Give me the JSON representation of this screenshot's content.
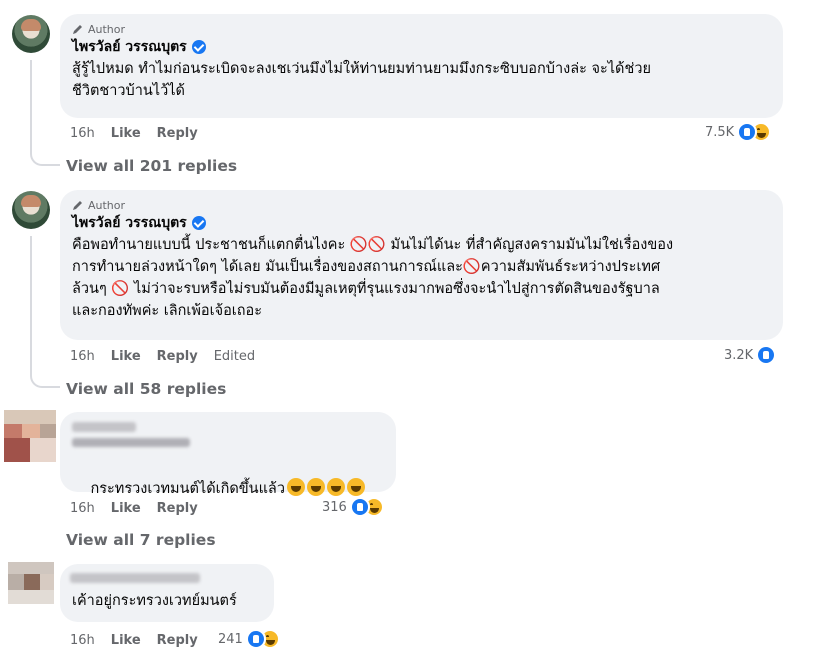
{
  "comments": [
    {
      "author_tag": "Author",
      "name": "ไพรวัลย์ วรรณบุตร",
      "text": "สู้รู้ไปหมด ทำไมก่อนระเบิดจะลงเชเว่นมึงไม่ให้ท่านยมท่านยามมึงกระซิบบอกบ้างล่ะ จะได้ช่วย\nชีวิตชาวบ้านไว้ได้",
      "time": "16h",
      "like": "Like",
      "reply": "Reply",
      "reaction_count": "7.5K",
      "view_replies": "View all 201 replies"
    },
    {
      "author_tag": "Author",
      "name": "ไพรวัลย์ วรรณบุตร",
      "text": "คือพอทำนายแบบนี้ ประชาชนก็แตกตื่นไงคะ 🚫🚫 มันไม่ได้นะ ที่สำคัญสงครามมันไม่ใช่เรื่องของ\nการทำนายล่วงหน้าใดๆ ได้เลย มันเป็นเรื่องของสถานการณ์และ🚫ความสัมพันธ์ระหว่างประเทศ\nล้วนๆ 🚫 ไม่ว่าจะรบหรือไม่รบมันต้องมีมูลเหตุที่รุนแรงมากพอซึ่งจะนำไปสู่การตัดสินของรัฐบาล\nและกองทัพค่ะ เลิกเพ้อเจ้อเถอะ",
      "time": "16h",
      "like": "Like",
      "reply": "Reply",
      "edited": "Edited",
      "reaction_count": "3.2K",
      "view_replies": "View all 58 replies"
    },
    {
      "text": "กระทรวงเวทมนต์ได้เกิดขึ้นแล้ว",
      "time": "16h",
      "like": "Like",
      "reply": "Reply",
      "reaction_count": "316",
      "view_replies": "View all 7 replies"
    },
    {
      "text": "เค้าอยู่กระทรวงเวทย์มนตร์",
      "time": "16h",
      "like": "Like",
      "reply": "Reply",
      "reaction_count": "241"
    }
  ]
}
